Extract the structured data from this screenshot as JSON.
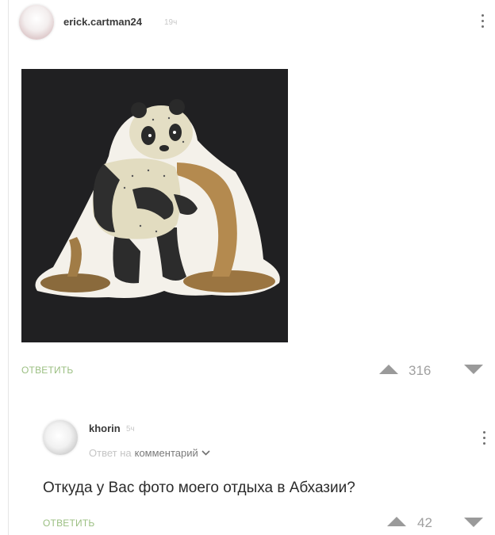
{
  "post": {
    "author": "erick.cartman24",
    "time": "19ч",
    "image_description": "",
    "reply_label": "ОТВЕТИТЬ",
    "score": "316"
  },
  "reply": {
    "author": "khorin",
    "time": "5ч",
    "reply_to_prefix": "Ответ на",
    "reply_to_target": "комментарий",
    "text": "Откуда у Вас фото моего отдыха в Абхазии?",
    "reply_label": "ОТВЕТИТЬ",
    "score": "42"
  },
  "colors": {
    "reply_link": "#9bbf82",
    "score": "#a0a0a0",
    "image_bg": "#202022"
  },
  "icons": {
    "more": "kebab-menu-icon",
    "upvote": "triangle-up-icon",
    "downvote": "triangle-down-icon",
    "expand": "chevron-down-icon"
  }
}
